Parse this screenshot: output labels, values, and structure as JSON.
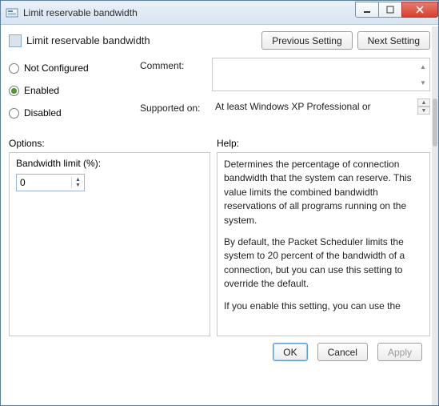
{
  "window": {
    "title": "Limit reservable bandwidth"
  },
  "header": {
    "title": "Limit reservable bandwidth",
    "prev_btn": "Previous Setting",
    "next_btn": "Next Setting"
  },
  "state": {
    "not_configured": "Not Configured",
    "enabled": "Enabled",
    "disabled": "Disabled",
    "selected": "enabled"
  },
  "fields": {
    "comment_label": "Comment:",
    "comment_value": "",
    "supported_label": "Supported on:",
    "supported_value": "At least Windows XP Professional or"
  },
  "sections": {
    "options_label": "Options:",
    "help_label": "Help:"
  },
  "options": {
    "bandwidth_label": "Bandwidth limit (%):",
    "bandwidth_value": "0"
  },
  "help": {
    "p1": "Determines the percentage of connection bandwidth that the system can reserve. This value limits the combined bandwidth reservations of all programs running on the system.",
    "p2": "By default, the Packet Scheduler limits the system to 20 percent of the bandwidth of a connection, but you can use this setting to override the default.",
    "p3": "If you enable this setting, you can use the"
  },
  "footer": {
    "ok": "OK",
    "cancel": "Cancel",
    "apply": "Apply"
  }
}
